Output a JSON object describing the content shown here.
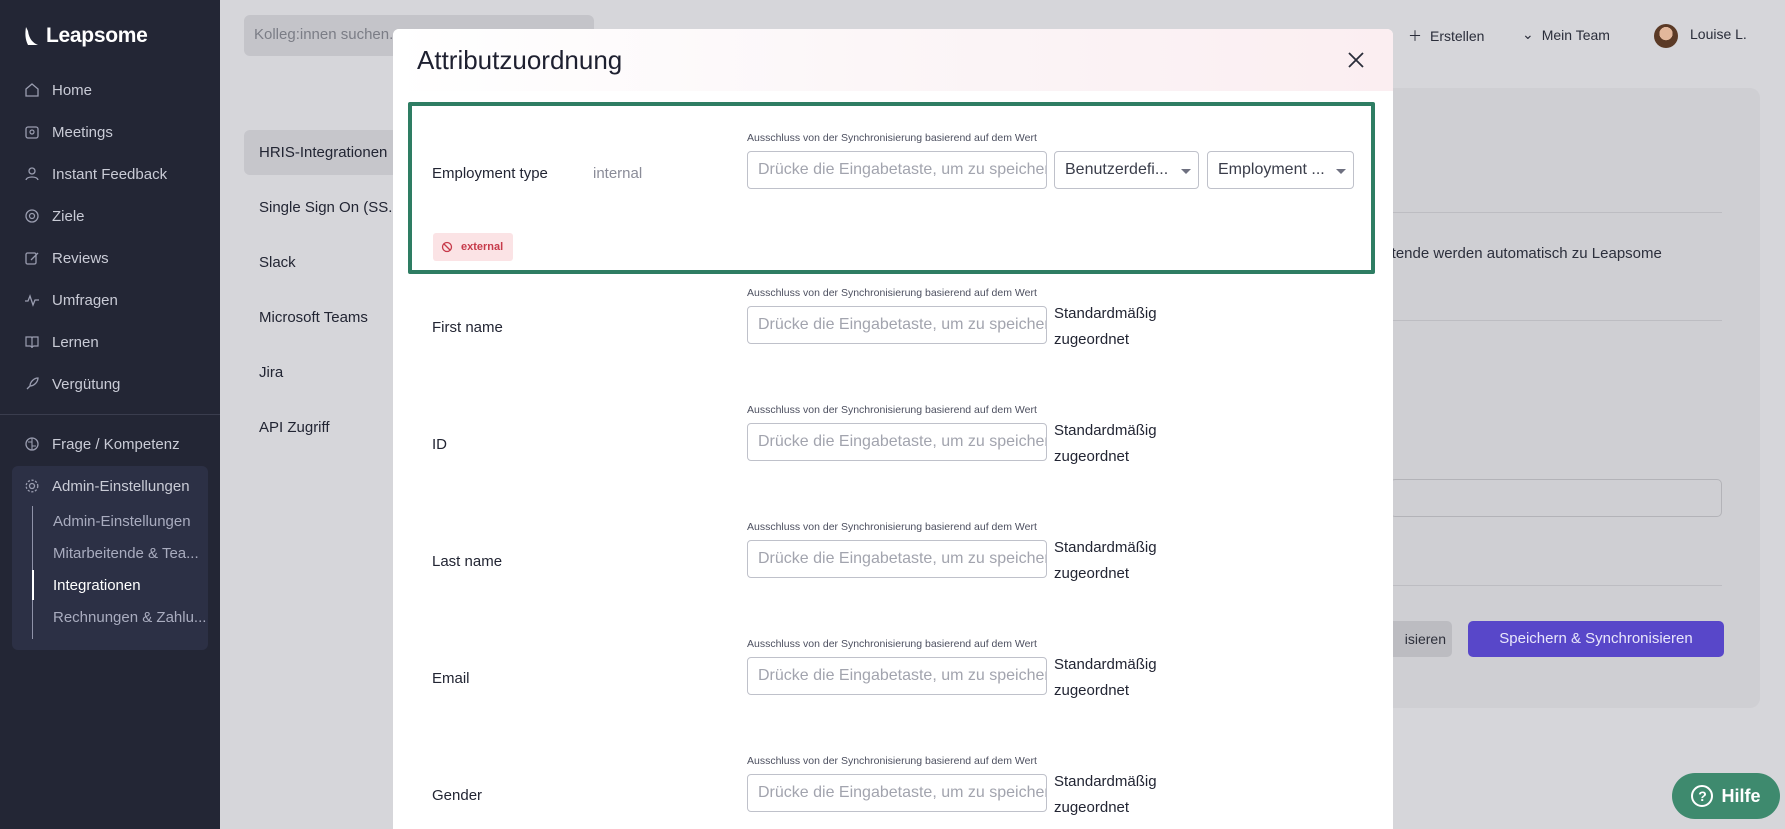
{
  "app": {
    "name": "Leapsome"
  },
  "sidebar": {
    "items": [
      {
        "label": "Home",
        "icon": "home-icon"
      },
      {
        "label": "Meetings",
        "icon": "meetings-icon"
      },
      {
        "label": "Instant Feedback",
        "icon": "feedback-icon"
      },
      {
        "label": "Ziele",
        "icon": "target-icon"
      },
      {
        "label": "Reviews",
        "icon": "edit-icon"
      },
      {
        "label": "Umfragen",
        "icon": "pulse-icon"
      },
      {
        "label": "Lernen",
        "icon": "book-icon"
      },
      {
        "label": "Vergütung",
        "icon": "rocket-icon"
      }
    ],
    "secondary": {
      "label": "Frage / Kompetenz",
      "icon": "brain-icon"
    },
    "admin": {
      "label": "Admin-Einstellungen",
      "icon": "gear-icon",
      "sub_items": [
        {
          "label": "Admin-Einstellungen"
        },
        {
          "label": "Mitarbeitende & Tea..."
        },
        {
          "label": "Integrationen",
          "active": true
        },
        {
          "label": "Rechnungen & Zahlu..."
        }
      ]
    }
  },
  "topbar": {
    "search_placeholder": "Kolleg:innen suchen...",
    "create_label": "Erstellen",
    "team_label": "Mein Team",
    "user_name": "Louise L."
  },
  "integrations_tabs": [
    {
      "label": "HRIS-Integrationen",
      "active": true
    },
    {
      "label": "Single Sign On (SS..."
    },
    {
      "label": "Slack"
    },
    {
      "label": "Microsoft Teams"
    },
    {
      "label": "Jira"
    },
    {
      "label": "API Zugriff"
    }
  ],
  "background": {
    "info_text": "eitende werden automatisch zu Leapsome",
    "button_secondary": "isieren",
    "button_primary": "Speichern & Synchronisieren"
  },
  "modal": {
    "title": "Attributzuordnung",
    "exclude_label": "Ausschluss von der Synchronisierung basierend auf dem Wert",
    "input_placeholder": "Drücke die Eingabetaste, um zu speichern",
    "default_mapped_line1": "Standardmäßig",
    "default_mapped_line2": "zugeordnet",
    "highlighted_row": {
      "name": "Employment type",
      "value": "internal",
      "select1": "Benutzerdefi...",
      "select2": "Employment ...",
      "excluded_tag": "external"
    },
    "rows": [
      {
        "name": "First name"
      },
      {
        "name": "ID"
      },
      {
        "name": "Last name"
      },
      {
        "name": "Email"
      },
      {
        "name": "Gender"
      }
    ]
  },
  "help": {
    "label": "Hilfe"
  },
  "colors": {
    "sidebar_bg": "#232635",
    "primary": "#5847c9",
    "highlight_border": "#2e7d63",
    "help_bg": "#3e8a6e",
    "danger_tag": "#c73a4a"
  }
}
